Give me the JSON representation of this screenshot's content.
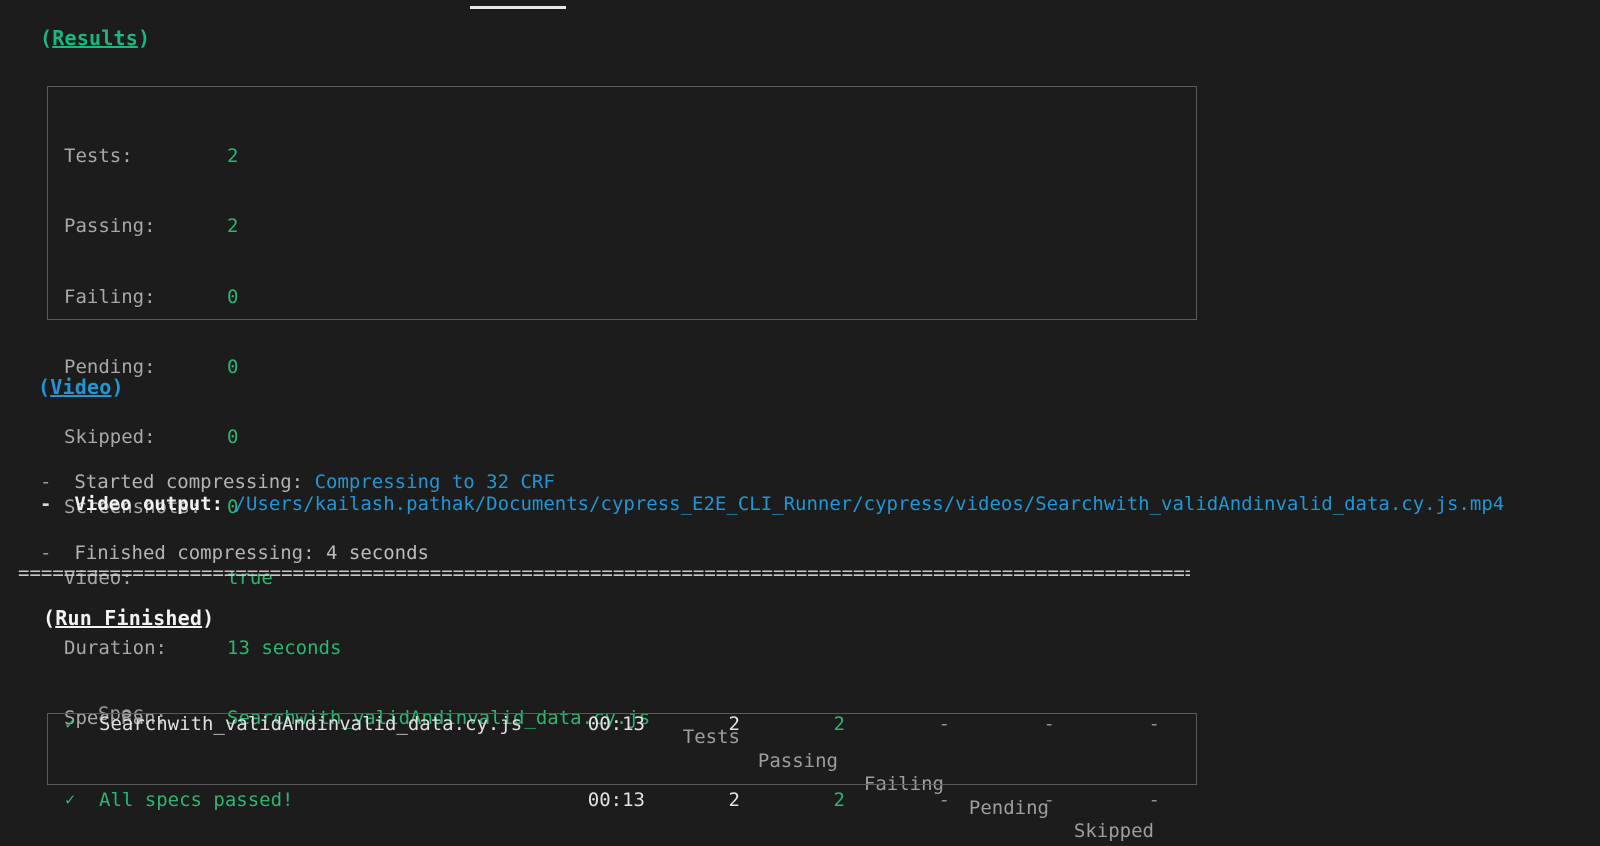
{
  "terminal": {
    "background": "#1c1c1c",
    "accent_green": "#2fb56f",
    "accent_blue": "#2196d4",
    "text_gray": "#b4b4b4"
  },
  "results_section": {
    "title_open_paren": "(",
    "title_name": "Results",
    "title_close_paren": ")",
    "rows": [
      {
        "label": "Tests:",
        "value": "2"
      },
      {
        "label": "Passing:",
        "value": "2"
      },
      {
        "label": "Failing:",
        "value": "0"
      },
      {
        "label": "Pending:",
        "value": "0"
      },
      {
        "label": "Skipped:",
        "value": "0"
      },
      {
        "label": "Screenshots:",
        "value": "0"
      },
      {
        "label": "Video:",
        "value": "true"
      },
      {
        "label": "Duration:",
        "value": "13 seconds"
      },
      {
        "label": "Spec Ran:",
        "value": "Searchwith_validAndinvalid_data.cy.js"
      }
    ]
  },
  "video_section": {
    "title_open_paren": "(",
    "title_name": "Video",
    "title_close_paren": ")",
    "lines": [
      {
        "dash": "-",
        "label": "Started compressing: ",
        "value": "Compressing to 32 CRF",
        "value_style": "highlight"
      },
      {
        "dash": "-",
        "label": "Finished compressing: ",
        "value": "4 seconds",
        "value_style": "plain"
      }
    ],
    "output": {
      "dash": "-",
      "label": "Video output: ",
      "path": "/Users/kailash.pathak/Documents/cypress_E2E_CLI_Runner/cypress/videos/Searchwith_validAndinvalid_data.cy.js.mp4"
    }
  },
  "separator": "====================================================================================================================================================",
  "run_finished_section": {
    "title_open_paren": "(",
    "title_name": "Run Finished",
    "title_close_paren": ")",
    "table": {
      "headers": {
        "spec": "Spec",
        "tests": "Tests",
        "passing": "Passing",
        "failing": "Failing",
        "pending": "Pending",
        "skipped": "Skipped"
      },
      "rows": [
        {
          "status_icon": "✓",
          "spec": "Searchwith_validAndinvalid_data.cy.js",
          "duration": "00:13",
          "tests": "2",
          "passing": "2",
          "failing": "-",
          "pending": "-",
          "skipped": "-"
        }
      ],
      "summary_row": {
        "status_icon": "✓",
        "label": "All specs passed!",
        "duration": "00:13",
        "tests": "2",
        "passing": "2",
        "failing": "-",
        "pending": "-",
        "skipped": "-"
      }
    }
  }
}
